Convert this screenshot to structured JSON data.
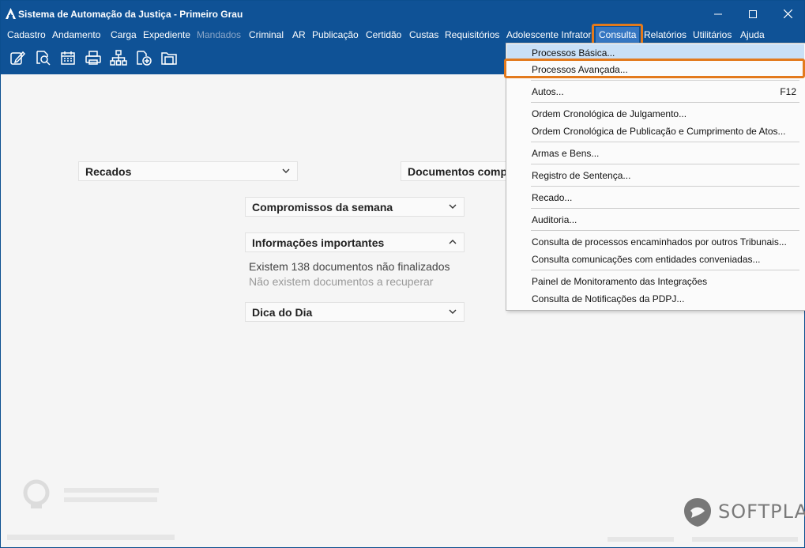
{
  "window": {
    "title": "Sistema de Automação da Justiça - Primeiro Grau"
  },
  "menubar": {
    "items": [
      "Cadastro",
      "Andamento",
      "Carga",
      "Expediente",
      "Mandados",
      "Criminal",
      "AR",
      "Publicação",
      "Certidão",
      "Custas",
      "Requisitórios",
      "Adolescente Infrator",
      "Consulta",
      "Relatórios",
      "Utilitários",
      "Ajuda"
    ],
    "disabled": [
      "Mandados"
    ],
    "active": "Consulta"
  },
  "toolbar": {
    "icons": [
      "edit-icon",
      "search-document-icon",
      "calendar-icon",
      "printer-icon",
      "hierarchy-icon",
      "add-document-icon",
      "folder-icon"
    ]
  },
  "panels": {
    "recados": "Recados",
    "documentos": "Documentos compa",
    "compromissos": "Compromissos da semana",
    "informacoes": "Informações importantes",
    "info_line1": "Existem 138 documentos não finalizados",
    "info_line2": "Não existem documentos a recuperar",
    "dica": "Dica do Dia"
  },
  "consulta_menu": {
    "items": [
      {
        "label": "Processos Básica...",
        "shortcut": ""
      },
      {
        "label": "Processos Avançada...",
        "shortcut": ""
      },
      {
        "label": "Autos...",
        "shortcut": "F12"
      },
      {
        "label": "Ordem Cronológica de Julgamento...",
        "shortcut": ""
      },
      {
        "label": "Ordem Cronológica de Publicação e Cumprimento de Atos...",
        "shortcut": ""
      },
      {
        "label": "Armas e Bens...",
        "shortcut": ""
      },
      {
        "label": "Registro de Sentença...",
        "shortcut": ""
      },
      {
        "label": "Recado...",
        "shortcut": ""
      },
      {
        "label": "Auditoria...",
        "shortcut": ""
      },
      {
        "label": "Consulta de processos encaminhados por outros Tribunais...",
        "shortcut": ""
      },
      {
        "label": "Consulta comunicações com entidades conveniadas...",
        "shortcut": ""
      },
      {
        "label": "Painel de Monitoramento das Integrações",
        "shortcut": ""
      },
      {
        "label": "Consulta de Notificações da PDPJ...",
        "shortcut": ""
      }
    ]
  },
  "footer": {
    "brand": "SOFTPLAN"
  },
  "colors": {
    "titlebar": "#0f5296",
    "highlight": "#e37a1d",
    "menu_selected": "#c9e0f7"
  }
}
